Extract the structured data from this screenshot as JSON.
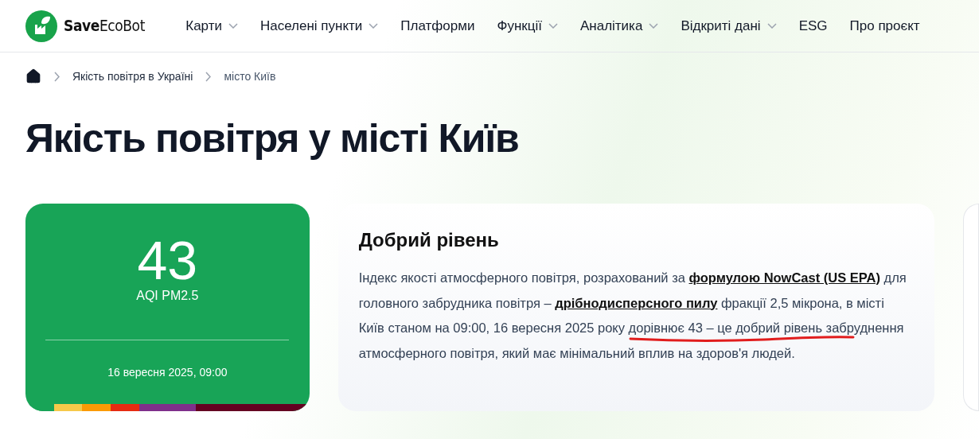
{
  "logo": {
    "text": "**Save**EcoBot"
  },
  "nav": [
    {
      "label": "Карти",
      "dropdown": true
    },
    {
      "label": "Населені пункти",
      "dropdown": true
    },
    {
      "label": "Платформи",
      "dropdown": false
    },
    {
      "label": "Функції",
      "dropdown": true
    },
    {
      "label": "Аналітика",
      "dropdown": true
    },
    {
      "label": "Відкриті дані",
      "dropdown": true
    },
    {
      "label": "ESG",
      "dropdown": false
    },
    {
      "label": "Про проєкт",
      "dropdown": false
    }
  ],
  "breadcrumb": [
    "Якість повітря в Україні",
    "місто Київ"
  ],
  "title": "Якість повітря у місті Київ",
  "aqi_card": {
    "value": "43",
    "label": "AQI PM2.5",
    "date": "16 вересня 2025, 09:00",
    "color": "#18a457",
    "scale": [
      {
        "color": "#18a457"
      },
      {
        "color": "#f6c94a"
      },
      {
        "color": "#fb9a06"
      },
      {
        "color": "#e62b12"
      },
      {
        "color": "#7f2f8b"
      },
      {
        "color": "#640021"
      }
    ]
  },
  "info_card": {
    "heading": "Добрий рівень",
    "segments": [
      {
        "kind": "text",
        "text": "Індекс якості атмосферного повітря, розрахований за "
      },
      {
        "kind": "link",
        "text": "формулою NowCast (US EPA)"
      },
      {
        "kind": "text",
        "text": " для головного забрудника повітря – "
      },
      {
        "kind": "link",
        "text": "дрібнодисперсного пилу"
      },
      {
        "kind": "text",
        "text": " фракції 2,5 мікрона, в місті Київ станом на 09:00, 16 вересня 2025 року "
      },
      {
        "kind": "marked",
        "text": "дорівнює 43 – це добрий рівень"
      },
      {
        "kind": "text",
        "text": " забруднення атмосферного повітря, який має мінімальний вплив на здоров'я людей."
      }
    ]
  }
}
